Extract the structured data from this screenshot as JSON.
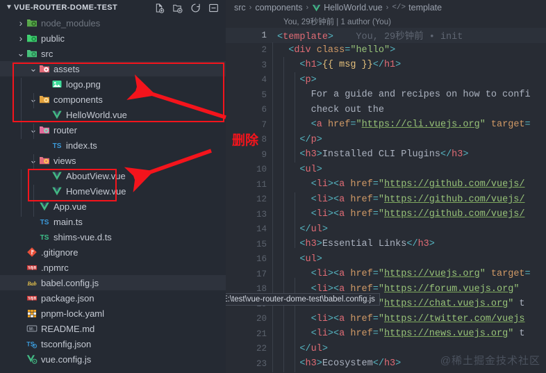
{
  "sidebar": {
    "title": "VUE-ROUTER-DOME-TEST",
    "actions": [
      {
        "name": "new-file-icon",
        "label": "New File"
      },
      {
        "name": "new-folder-icon",
        "label": "New Folder"
      },
      {
        "name": "refresh-icon",
        "label": "Refresh Explorer"
      },
      {
        "name": "collapse-all-icon",
        "label": "Collapse Folders in Explorer"
      }
    ],
    "tree": [
      {
        "label": "node_modules",
        "kind": "folder",
        "icon": "folder-node-icon",
        "indent": 1,
        "twisty": "›",
        "dim": true,
        "selected": false
      },
      {
        "label": "public",
        "kind": "folder",
        "icon": "folder-public-icon",
        "indent": 1,
        "twisty": "›",
        "dim": false,
        "selected": false
      },
      {
        "label": "src",
        "kind": "folder",
        "icon": "folder-src-icon",
        "indent": 1,
        "twisty": "∨",
        "dim": false,
        "selected": false
      },
      {
        "label": "assets",
        "kind": "folder",
        "icon": "folder-assets-icon",
        "indent": 2,
        "twisty": "∨",
        "dim": false,
        "selected": true
      },
      {
        "label": "logo.png",
        "kind": "file",
        "icon": "image-file-icon",
        "indent": 3,
        "twisty": "",
        "dim": false,
        "selected": false
      },
      {
        "label": "components",
        "kind": "folder",
        "icon": "folder-components-icon",
        "indent": 2,
        "twisty": "∨",
        "dim": false,
        "selected": false
      },
      {
        "label": "HelloWorld.vue",
        "kind": "file",
        "icon": "vue-file-icon",
        "indent": 3,
        "twisty": "",
        "dim": false,
        "selected": false
      },
      {
        "label": "router",
        "kind": "folder",
        "icon": "folder-router-icon",
        "indent": 2,
        "twisty": "∨",
        "dim": false,
        "selected": false
      },
      {
        "label": "index.ts",
        "kind": "file",
        "icon": "ts-file-icon",
        "indent": 3,
        "twisty": "",
        "dim": false,
        "selected": false
      },
      {
        "label": "views",
        "kind": "folder",
        "icon": "folder-views-icon",
        "indent": 2,
        "twisty": "∨",
        "dim": false,
        "selected": false
      },
      {
        "label": "AboutView.vue",
        "kind": "file",
        "icon": "vue-file-icon",
        "indent": 3,
        "twisty": "",
        "dim": false,
        "selected": false
      },
      {
        "label": "HomeView.vue",
        "kind": "file",
        "icon": "vue-file-icon",
        "indent": 3,
        "twisty": "",
        "dim": false,
        "selected": false
      },
      {
        "label": "App.vue",
        "kind": "file",
        "icon": "vue-file-icon",
        "indent": 2,
        "twisty": "",
        "dim": false,
        "selected": false
      },
      {
        "label": "main.ts",
        "kind": "file",
        "icon": "ts-file-icon",
        "indent": 2,
        "twisty": "",
        "dim": false,
        "selected": false
      },
      {
        "label": "shims-vue.d.ts",
        "kind": "file",
        "icon": "ts-def-file-icon",
        "indent": 2,
        "twisty": "",
        "dim": false,
        "selected": false
      },
      {
        "label": ".gitignore",
        "kind": "file",
        "icon": "git-file-icon",
        "indent": 1,
        "twisty": "",
        "dim": false,
        "selected": false
      },
      {
        "label": ".npmrc",
        "kind": "file",
        "icon": "npm-file-icon",
        "indent": 1,
        "twisty": "",
        "dim": false,
        "selected": false
      },
      {
        "label": "babel.config.js",
        "kind": "file",
        "icon": "babel-file-icon",
        "indent": 1,
        "twisty": "",
        "dim": false,
        "selected": true
      },
      {
        "label": "package.json",
        "kind": "file",
        "icon": "npm-file-icon",
        "indent": 1,
        "twisty": "",
        "dim": false,
        "selected": false
      },
      {
        "label": "pnpm-lock.yaml",
        "kind": "file",
        "icon": "yaml-file-icon",
        "indent": 1,
        "twisty": "",
        "dim": false,
        "selected": false
      },
      {
        "label": "README.md",
        "kind": "file",
        "icon": "markdown-file-icon",
        "indent": 1,
        "twisty": "",
        "dim": false,
        "selected": false
      },
      {
        "label": "tsconfig.json",
        "kind": "file",
        "icon": "tsconfig-file-icon",
        "indent": 1,
        "twisty": "",
        "dim": false,
        "selected": false
      },
      {
        "label": "vue.config.js",
        "kind": "file",
        "icon": "vue-config-file-icon",
        "indent": 1,
        "twisty": "",
        "dim": false,
        "selected": false
      }
    ]
  },
  "breadcrumb": {
    "part1": "src",
    "part2": "components",
    "part3": "HelloWorld.vue",
    "part4": "template",
    "separator": "›"
  },
  "codelens": "You, 29秒钟前 | 1 author (You)",
  "editor": {
    "inline_blame": "You, 29秒钟前 • init",
    "lines": [
      {
        "num": "1",
        "active": true,
        "indent": 0,
        "segs": [
          {
            "t": "brk",
            "v": "<"
          },
          {
            "t": "tag",
            "v": "template"
          },
          {
            "t": "brk",
            "v": ">"
          }
        ]
      },
      {
        "num": "2",
        "active": false,
        "indent": 1,
        "segs": [
          {
            "t": "brk",
            "v": "<"
          },
          {
            "t": "tag",
            "v": "div"
          },
          {
            "t": "txt",
            "v": " "
          },
          {
            "t": "attr",
            "v": "class"
          },
          {
            "t": "brk",
            "v": "="
          },
          {
            "t": "str",
            "v": "\"hello\""
          },
          {
            "t": "brk",
            "v": ">"
          }
        ]
      },
      {
        "num": "3",
        "active": false,
        "indent": 2,
        "segs": [
          {
            "t": "brk",
            "v": "<"
          },
          {
            "t": "tag",
            "v": "h1"
          },
          {
            "t": "brk",
            "v": ">"
          },
          {
            "t": "mus",
            "v": "{{ msg }}"
          },
          {
            "t": "brk",
            "v": "</"
          },
          {
            "t": "tag",
            "v": "h1"
          },
          {
            "t": "brk",
            "v": ">"
          }
        ]
      },
      {
        "num": "4",
        "active": false,
        "indent": 2,
        "segs": [
          {
            "t": "brk",
            "v": "<"
          },
          {
            "t": "tag",
            "v": "p"
          },
          {
            "t": "brk",
            "v": ">"
          }
        ]
      },
      {
        "num": "5",
        "active": false,
        "indent": 3,
        "segs": [
          {
            "t": "txt",
            "v": "For a guide and recipes on how to confi"
          }
        ]
      },
      {
        "num": "6",
        "active": false,
        "indent": 3,
        "segs": [
          {
            "t": "txt",
            "v": "check out the"
          }
        ]
      },
      {
        "num": "7",
        "active": false,
        "indent": 3,
        "segs": [
          {
            "t": "brk",
            "v": "<"
          },
          {
            "t": "tag",
            "v": "a"
          },
          {
            "t": "txt",
            "v": " "
          },
          {
            "t": "attr",
            "v": "href"
          },
          {
            "t": "brk",
            "v": "="
          },
          {
            "t": "str",
            "v": "\""
          },
          {
            "t": "link",
            "v": "https://cli.vuejs.org"
          },
          {
            "t": "str",
            "v": "\""
          },
          {
            "t": "txt",
            "v": " "
          },
          {
            "t": "attr",
            "v": "target"
          },
          {
            "t": "brk",
            "v": "="
          }
        ]
      },
      {
        "num": "8",
        "active": false,
        "indent": 2,
        "segs": [
          {
            "t": "brk",
            "v": "</"
          },
          {
            "t": "tag",
            "v": "p"
          },
          {
            "t": "brk",
            "v": ">"
          }
        ]
      },
      {
        "num": "9",
        "active": false,
        "indent": 2,
        "segs": [
          {
            "t": "brk",
            "v": "<"
          },
          {
            "t": "tag",
            "v": "h3"
          },
          {
            "t": "brk",
            "v": ">"
          },
          {
            "t": "txt",
            "v": "Installed CLI Plugins"
          },
          {
            "t": "brk",
            "v": "</"
          },
          {
            "t": "tag",
            "v": "h3"
          },
          {
            "t": "brk",
            "v": ">"
          }
        ]
      },
      {
        "num": "10",
        "active": false,
        "indent": 2,
        "segs": [
          {
            "t": "brk",
            "v": "<"
          },
          {
            "t": "tag",
            "v": "ul"
          },
          {
            "t": "brk",
            "v": ">"
          }
        ]
      },
      {
        "num": "11",
        "active": false,
        "indent": 3,
        "segs": [
          {
            "t": "brk",
            "v": "<"
          },
          {
            "t": "tag",
            "v": "li"
          },
          {
            "t": "brk",
            "v": "><"
          },
          {
            "t": "tag",
            "v": "a"
          },
          {
            "t": "txt",
            "v": " "
          },
          {
            "t": "attr",
            "v": "href"
          },
          {
            "t": "brk",
            "v": "="
          },
          {
            "t": "str",
            "v": "\""
          },
          {
            "t": "link",
            "v": "https://github.com/vuejs/"
          }
        ]
      },
      {
        "num": "12",
        "active": false,
        "indent": 3,
        "segs": [
          {
            "t": "brk",
            "v": "<"
          },
          {
            "t": "tag",
            "v": "li"
          },
          {
            "t": "brk",
            "v": "><"
          },
          {
            "t": "tag",
            "v": "a"
          },
          {
            "t": "txt",
            "v": " "
          },
          {
            "t": "attr",
            "v": "href"
          },
          {
            "t": "brk",
            "v": "="
          },
          {
            "t": "str",
            "v": "\""
          },
          {
            "t": "link",
            "v": "https://github.com/vuejs/"
          }
        ]
      },
      {
        "num": "13",
        "active": false,
        "indent": 3,
        "segs": [
          {
            "t": "brk",
            "v": "<"
          },
          {
            "t": "tag",
            "v": "li"
          },
          {
            "t": "brk",
            "v": "><"
          },
          {
            "t": "tag",
            "v": "a"
          },
          {
            "t": "txt",
            "v": " "
          },
          {
            "t": "attr",
            "v": "href"
          },
          {
            "t": "brk",
            "v": "="
          },
          {
            "t": "str",
            "v": "\""
          },
          {
            "t": "link",
            "v": "https://github.com/vuejs/"
          }
        ]
      },
      {
        "num": "14",
        "active": false,
        "indent": 2,
        "segs": [
          {
            "t": "brk",
            "v": "</"
          },
          {
            "t": "tag",
            "v": "ul"
          },
          {
            "t": "brk",
            "v": ">"
          }
        ]
      },
      {
        "num": "15",
        "active": false,
        "indent": 2,
        "segs": [
          {
            "t": "brk",
            "v": "<"
          },
          {
            "t": "tag",
            "v": "h3"
          },
          {
            "t": "brk",
            "v": ">"
          },
          {
            "t": "txt",
            "v": "Essential Links"
          },
          {
            "t": "brk",
            "v": "</"
          },
          {
            "t": "tag",
            "v": "h3"
          },
          {
            "t": "brk",
            "v": ">"
          }
        ]
      },
      {
        "num": "16",
        "active": false,
        "indent": 2,
        "segs": [
          {
            "t": "brk",
            "v": "<"
          },
          {
            "t": "tag",
            "v": "ul"
          },
          {
            "t": "brk",
            "v": ">"
          }
        ]
      },
      {
        "num": "17",
        "active": false,
        "indent": 3,
        "segs": [
          {
            "t": "brk",
            "v": "<"
          },
          {
            "t": "tag",
            "v": "li"
          },
          {
            "t": "brk",
            "v": "><"
          },
          {
            "t": "tag",
            "v": "a"
          },
          {
            "t": "txt",
            "v": " "
          },
          {
            "t": "attr",
            "v": "href"
          },
          {
            "t": "brk",
            "v": "="
          },
          {
            "t": "str",
            "v": "\""
          },
          {
            "t": "link",
            "v": "https://vuejs.org"
          },
          {
            "t": "str",
            "v": "\""
          },
          {
            "t": "txt",
            "v": " "
          },
          {
            "t": "attr",
            "v": "target"
          },
          {
            "t": "brk",
            "v": "="
          }
        ]
      },
      {
        "num": "18",
        "active": false,
        "indent": 3,
        "segs": [
          {
            "t": "brk",
            "v": "<"
          },
          {
            "t": "tag",
            "v": "li"
          },
          {
            "t": "brk",
            "v": "><"
          },
          {
            "t": "tag",
            "v": "a"
          },
          {
            "t": "txt",
            "v": " "
          },
          {
            "t": "attr",
            "v": "href"
          },
          {
            "t": "brk",
            "v": "="
          },
          {
            "t": "str",
            "v": "\""
          },
          {
            "t": "link",
            "v": "https://forum.vuejs.org"
          },
          {
            "t": "str",
            "v": "\""
          },
          {
            "t": "txt",
            "v": " "
          }
        ]
      },
      {
        "num": "19",
        "active": false,
        "indent": 3,
        "segs": [
          {
            "t": "brk",
            "v": "<"
          },
          {
            "t": "tag",
            "v": "li"
          },
          {
            "t": "brk",
            "v": "><"
          },
          {
            "t": "tag",
            "v": "a"
          },
          {
            "t": "txt",
            "v": " "
          },
          {
            "t": "attr",
            "v": "href"
          },
          {
            "t": "brk",
            "v": "="
          },
          {
            "t": "str",
            "v": "\""
          },
          {
            "t": "link",
            "v": "https://chat.vuejs.org"
          },
          {
            "t": "str",
            "v": "\""
          },
          {
            "t": "txt",
            "v": " t"
          }
        ]
      },
      {
        "num": "20",
        "active": false,
        "indent": 3,
        "segs": [
          {
            "t": "brk",
            "v": "<"
          },
          {
            "t": "tag",
            "v": "li"
          },
          {
            "t": "brk",
            "v": "><"
          },
          {
            "t": "tag",
            "v": "a"
          },
          {
            "t": "txt",
            "v": " "
          },
          {
            "t": "attr",
            "v": "href"
          },
          {
            "t": "brk",
            "v": "="
          },
          {
            "t": "str",
            "v": "\""
          },
          {
            "t": "link",
            "v": "https://twitter.com/vuejs"
          }
        ]
      },
      {
        "num": "21",
        "active": false,
        "indent": 3,
        "segs": [
          {
            "t": "brk",
            "v": "<"
          },
          {
            "t": "tag",
            "v": "li"
          },
          {
            "t": "brk",
            "v": "><"
          },
          {
            "t": "tag",
            "v": "a"
          },
          {
            "t": "txt",
            "v": " "
          },
          {
            "t": "attr",
            "v": "href"
          },
          {
            "t": "brk",
            "v": "="
          },
          {
            "t": "str",
            "v": "\""
          },
          {
            "t": "link",
            "v": "https://news.vuejs.org"
          },
          {
            "t": "str",
            "v": "\""
          },
          {
            "t": "txt",
            "v": " t"
          }
        ]
      },
      {
        "num": "22",
        "active": false,
        "indent": 2,
        "segs": [
          {
            "t": "brk",
            "v": "</"
          },
          {
            "t": "tag",
            "v": "ul"
          },
          {
            "t": "brk",
            "v": ">"
          }
        ]
      },
      {
        "num": "23",
        "active": false,
        "indent": 2,
        "segs": [
          {
            "t": "brk",
            "v": "<"
          },
          {
            "t": "tag",
            "v": "h3"
          },
          {
            "t": "brk",
            "v": ">"
          },
          {
            "t": "txt",
            "v": "Ecosystem"
          },
          {
            "t": "brk",
            "v": "</"
          },
          {
            "t": "tag",
            "v": "h3"
          },
          {
            "t": "brk",
            "v": ">"
          }
        ]
      }
    ]
  },
  "tooltip": "E:\\test\\vue-router-dome-test\\babel.config.js",
  "watermark": "@稀土掘金技术社区",
  "annotations": {
    "delete_label": "删除",
    "accent_color": "#f4141c"
  }
}
